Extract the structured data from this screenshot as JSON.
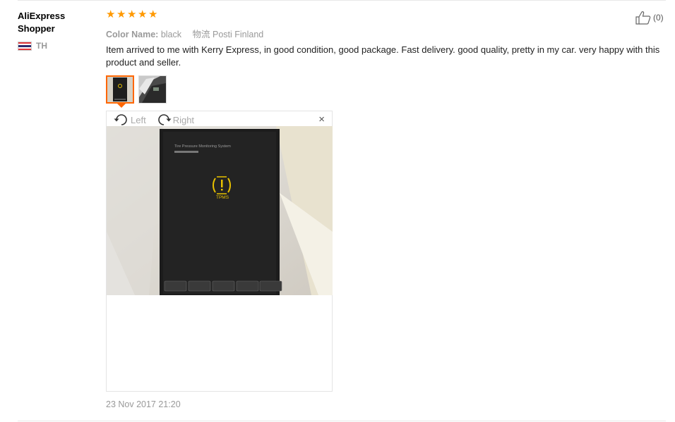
{
  "user": {
    "name": "AliExpress Shopper",
    "country_code": "TH"
  },
  "rating": {
    "stars": 5,
    "star_color": "#ff9900"
  },
  "sku": {
    "color_label": "Color Name:",
    "color_value": "black",
    "shipping_label": "物流",
    "shipping_value": "Posti Finland"
  },
  "like": {
    "count_text": "(0)"
  },
  "review": {
    "text": "Item arrived to me with Kerry Express, in good condition, good package. Fast delivery. good quality, pretty in my car. very happy with this product and seller."
  },
  "viewer": {
    "rotate_left": "Left",
    "rotate_right": "Right",
    "close_glyph": "×"
  },
  "photo": {
    "box_title": "Tire Pressure Monitoring System",
    "logo_text": "TPMS"
  },
  "date": "23 Nov 2017 21:20",
  "colors": {
    "accent": "#ff6600",
    "muted": "#999999"
  }
}
